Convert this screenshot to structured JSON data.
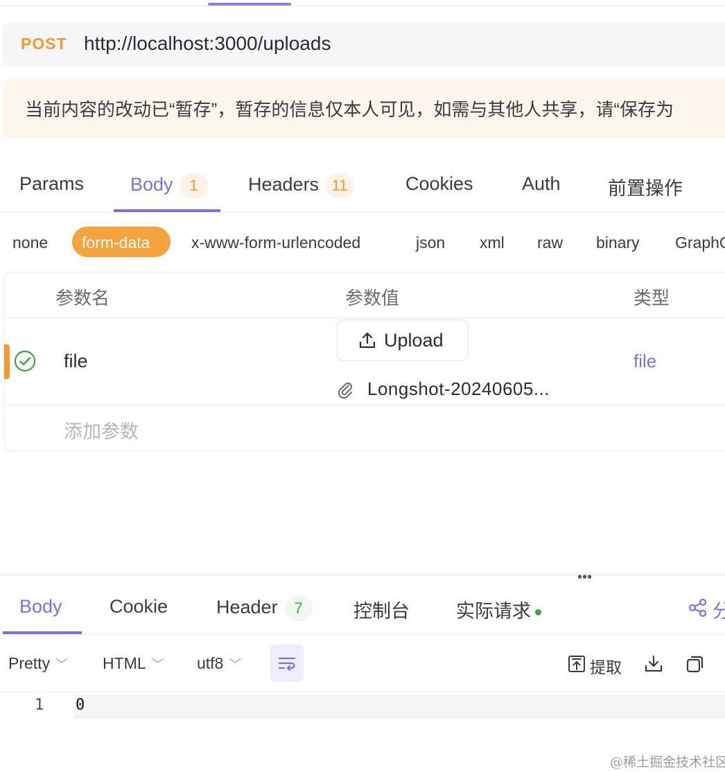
{
  "request": {
    "method": "POST",
    "url": "http://localhost:3000/uploads"
  },
  "notice": "当前内容的改动已“暂存”，暂存的信息仅本人可见，如需与其他人共享，请“保存为",
  "request_tabs": [
    {
      "label": "Params"
    },
    {
      "label": "Body",
      "badge": "1"
    },
    {
      "label": "Headers",
      "badge": "11"
    },
    {
      "label": "Cookies"
    },
    {
      "label": "Auth"
    },
    {
      "label": "前置操作"
    }
  ],
  "body_types": [
    "none",
    "form-data",
    "x-www-form-urlencoded",
    "json",
    "xml",
    "raw",
    "binary",
    "GraphQ"
  ],
  "body_selected": "form-data",
  "params_table": {
    "headers": [
      "参数名",
      "参数值",
      "类型"
    ],
    "rows": [
      {
        "name": "file",
        "upload_label": "Upload",
        "file_name": "Longshot-20240605...",
        "type": "file",
        "enabled": true
      }
    ],
    "add_placeholder": "添加参数"
  },
  "response_tabs": [
    {
      "label": "Body"
    },
    {
      "label": "Cookie"
    },
    {
      "label": "Header",
      "badge": "7"
    },
    {
      "label": "控制台"
    },
    {
      "label": "实际请求"
    }
  ],
  "share_label": "分",
  "toolbar": {
    "format": "Pretty",
    "language": "HTML",
    "encoding": "utf8",
    "extract_label": "提取"
  },
  "code": {
    "line_number": "1",
    "content": "0"
  },
  "watermark": "@稀土掘金技术社区",
  "colors": {
    "accent": "#7e6fe0",
    "method": "#f29a30",
    "success": "#43a047"
  },
  "icons": [
    "check-circle-icon",
    "upload-icon",
    "paperclip-icon",
    "share-icon",
    "wrap-lines-icon",
    "extract-icon",
    "download-icon",
    "copy-icon"
  ]
}
